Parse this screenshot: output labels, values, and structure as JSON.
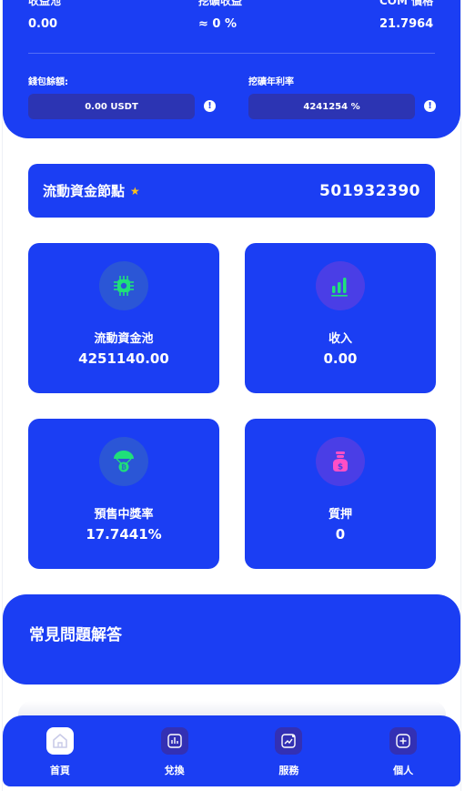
{
  "top": {
    "stats": [
      {
        "label": "收益池",
        "value": "0.00"
      },
      {
        "label": "挖礦收益",
        "value": "≈ 0 %"
      },
      {
        "label": "COM 價格",
        "value": "21.7964"
      }
    ],
    "wallet_label": "錢包餘額:",
    "wallet_value": "0.00 USDT",
    "rate_label": "挖礦年利率",
    "rate_value": "4241254 %",
    "info_glyph": "!"
  },
  "node": {
    "title": "流動資金節點",
    "value": "501932390"
  },
  "cards": [
    {
      "title": "流動資金池",
      "value": "4251140.00",
      "icon": "chip-icon"
    },
    {
      "title": "收入",
      "value": "0.00",
      "icon": "signal-bars-icon"
    },
    {
      "title": "預售中獎率",
      "value": "17.7441%",
      "icon": "bitcoin-parachute-icon"
    },
    {
      "title": "質押",
      "value": "0",
      "icon": "money-bag-icon"
    }
  ],
  "faq": {
    "title": "常見問題解答"
  },
  "nav": [
    {
      "label": "首頁",
      "icon": "home-icon",
      "active": true
    },
    {
      "label": "兌換",
      "icon": "chart-icon",
      "active": false
    },
    {
      "label": "服務",
      "icon": "trend-icon",
      "active": false
    },
    {
      "label": "個人",
      "icon": "plus-square-icon",
      "active": false
    }
  ],
  "colors": {
    "primary": "#1b3ef3",
    "accent_green": "#1fe07a",
    "accent_pink": "#ff4fc6",
    "star": "#ffc21a"
  }
}
